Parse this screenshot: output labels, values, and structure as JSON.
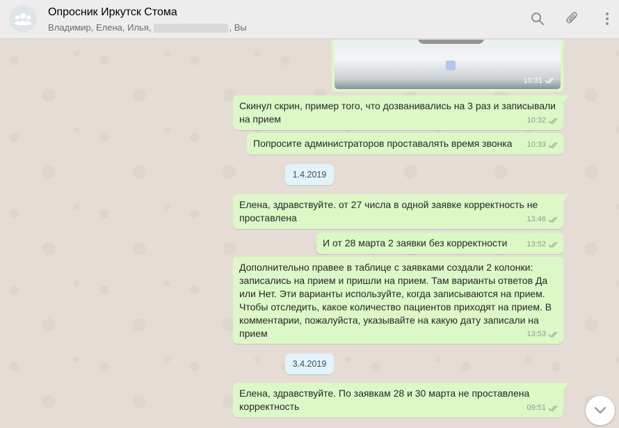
{
  "header": {
    "title": "Опросник Иркутск Стома",
    "participants_visible": "Владимир, Елена, Илья,",
    "participants_tail": ", Вы",
    "icons": [
      "group-avatar-icon",
      "search-icon",
      "attach-icon",
      "menu-icon"
    ]
  },
  "image_message": {
    "time": "10:31"
  },
  "messages": [
    {
      "text": "Скинул скрин, пример того, что дозванивались на 3 раз и записывали на прием",
      "time": "10:32"
    },
    {
      "text": "Попросите администраторов проставалять время звонка",
      "time": "10:33"
    },
    {
      "text": "Елена, здравствуйте. от 27 числа в одной заявке корректность не проставлена",
      "time": "13:46"
    },
    {
      "text": "И от 28 марта 2 заявки без корректности",
      "time": "13:52"
    },
    {
      "text": "Дополнительно правее в таблице с заявками создали 2 колонки: записались на прием и пришли на прием. Там варианты ответов Да или Нет. Эти варианты используйте, когда записываются на прием. Чтобы отследить, какое количество пациентов приходят на прием. В комментарии, пожалуйста, указывайте на какую дату записали на прием",
      "time": "13:53"
    },
    {
      "text": "Елена, здравствуйте. По заявкам 28 и 30 марта не проставлена корректность",
      "time": "09:51"
    }
  ],
  "dates": [
    "1.4.2019",
    "3.4.2019"
  ],
  "colors": {
    "outgoing_bubble": "#dcf8c6",
    "date_chip": "#e1f3fb",
    "header_bg": "#ededed",
    "chat_bg": "#e5ddd5"
  }
}
